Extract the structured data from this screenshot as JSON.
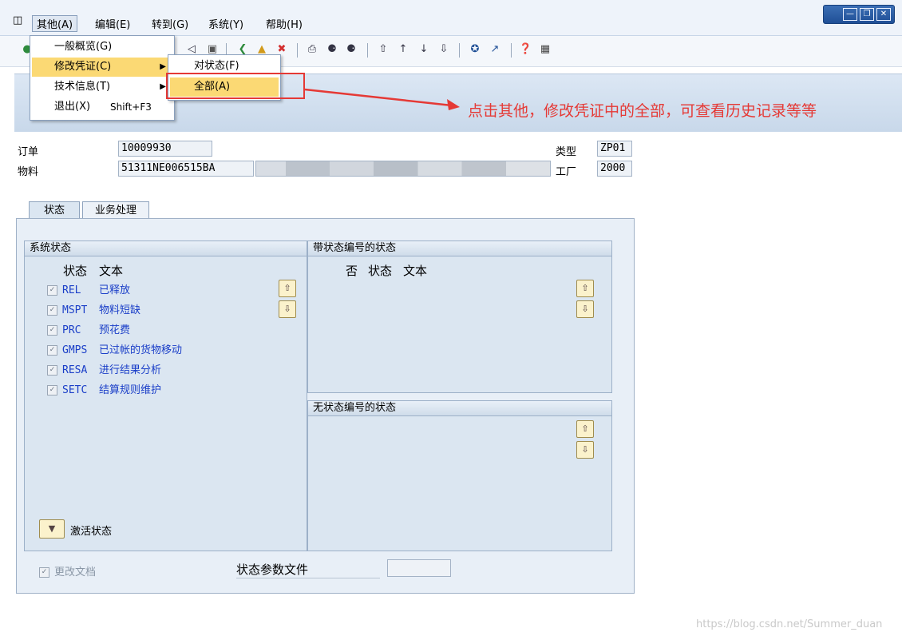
{
  "menubar": {
    "items": [
      "其他(A)",
      "编辑(E)",
      "转到(G)",
      "系统(Y)",
      "帮助(H)"
    ]
  },
  "dropdown": {
    "items": [
      {
        "label": "一般概览(G)",
        "shortcut": "",
        "submenu": false
      },
      {
        "label": "修改凭证(C)",
        "shortcut": "",
        "submenu": true
      },
      {
        "label": "技术信息(T)",
        "shortcut": "",
        "submenu": true
      },
      {
        "label": "退出(X)",
        "shortcut": "Shift+F3",
        "submenu": false
      }
    ],
    "highlighted": "修改凭证(C)"
  },
  "submenu": {
    "items": [
      "对状态(F)",
      "全部(A)"
    ],
    "highlighted": "全部(A)"
  },
  "annotation": {
    "text": "点击其他，修改凭证中的全部，可查看历史记录等等",
    "color": "#e53935"
  },
  "header": {
    "order_label": "订单",
    "order_value": "10009930",
    "material_label": "物料",
    "material_value": "51311NE006515BA",
    "type_label": "类型",
    "type_value": "ZP01",
    "plant_label": "工厂",
    "plant_value": "2000"
  },
  "tabs": [
    "状态",
    "业务处理"
  ],
  "system_status": {
    "title": "系统状态",
    "col_status": "状态",
    "col_text": "文本",
    "rows": [
      {
        "code": "REL",
        "text": "已释放"
      },
      {
        "code": "MSPT",
        "text": "物料短缺"
      },
      {
        "code": "PRC",
        "text": "预花费"
      },
      {
        "code": "GMPS",
        "text": "已过帐的货物移动"
      },
      {
        "code": "RESA",
        "text": "进行结果分析"
      },
      {
        "code": "SETC",
        "text": "结算规则维护"
      }
    ],
    "activate_label": "激活状态"
  },
  "status_with_no": {
    "title": "带状态编号的状态",
    "col_no": "否",
    "col_status": "状态",
    "col_text": "文本"
  },
  "status_without_no": {
    "title": "无状态编号的状态"
  },
  "footer": {
    "change_doc_label": "更改文档",
    "status_profile_label": "状态参数文件",
    "status_profile_value": ""
  },
  "watermark": "https://blog.csdn.net/Summer_duan",
  "colors": {
    "accent": "#fbd974",
    "status_text": "#1a3ec8",
    "annotation_red": "#e53935"
  }
}
